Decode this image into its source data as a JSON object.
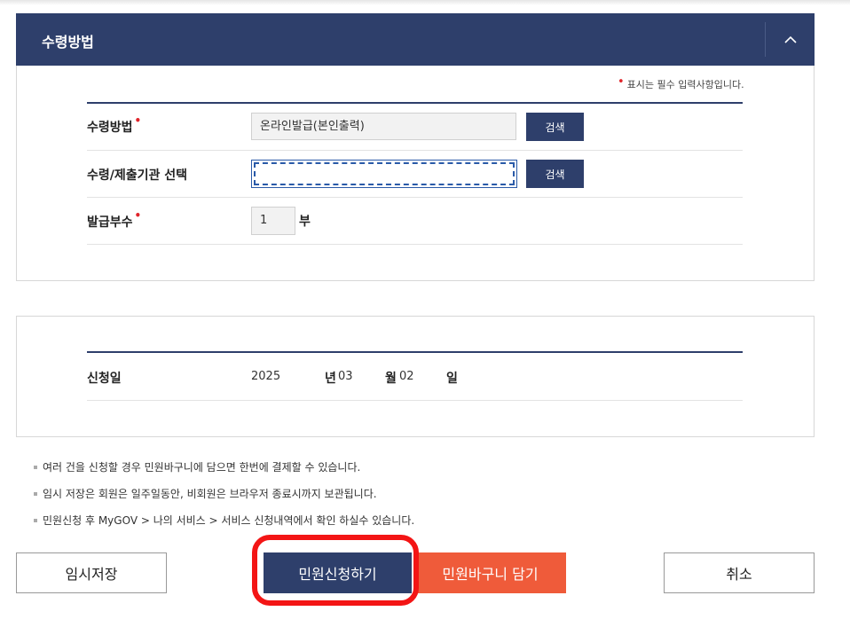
{
  "receipt": {
    "title": "수령방법",
    "required_note": "표시는 필수 입력사항입니다.",
    "required_mark": "•",
    "method_label": "수령방법",
    "method_value": "온라인발급(본인출력)",
    "org_label": "수령/제출기관 선택",
    "org_value": "",
    "search_label": "검색",
    "copies_label": "발급부수",
    "copies_value": "1",
    "copies_unit": "부"
  },
  "application": {
    "date_label": "신청일",
    "year": "2025",
    "year_unit": "년",
    "month": "03",
    "month_unit": "월",
    "day": "02",
    "day_unit": "일"
  },
  "notes": [
    "여러 건을 신청할 경우 민원바구니에 담으면 한번에 결제할 수 있습니다.",
    "임시 저장은 회원은 일주일동안, 비회원은 브라우저 종료시까지 보관됩니다.",
    "민원신청 후 MyGOV > 나의 서비스 > 서비스 신청내역에서 확인 하실수 있습니다."
  ],
  "buttons": {
    "temp_save": "임시저장",
    "apply": "민원신청하기",
    "basket": "민원바구니 담기",
    "cancel": "취소"
  },
  "colors": {
    "navy": "#2e3f6b",
    "orange": "#ef5b3a",
    "required": "#e0242a",
    "highlight": "#f31515"
  },
  "icons": {
    "collapse": "chevron-up-icon"
  }
}
